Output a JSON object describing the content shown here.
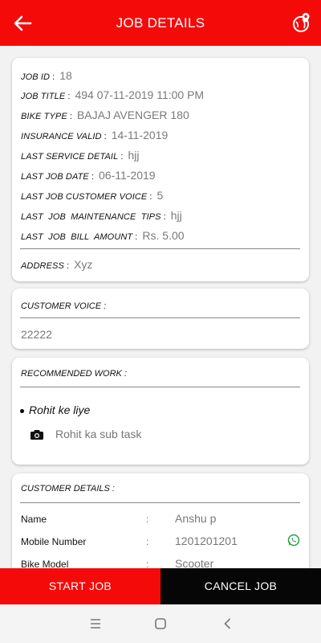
{
  "appbar": {
    "title": "JOB DETAILS",
    "back_icon": "arrow-left-icon",
    "map_icon": "map-pin-globe-icon",
    "color": "#f50a0a"
  },
  "job": {
    "job_id": {
      "label": "JOB ID",
      "value": "18"
    },
    "job_title": {
      "label": "JOB TITLE",
      "value": "494 07-11-2019 11:00 PM"
    },
    "bike_type": {
      "label": "BIKE TYPE",
      "value": "BAJAJ AVENGER 180"
    },
    "insurance_valid": {
      "label": "INSURANCE VALID",
      "value": "14-11-2019"
    },
    "last_service_detail": {
      "label": "LAST SERVICE DETAIL",
      "value": "hjj"
    },
    "last_job_date": {
      "label": "LAST JOB DATE",
      "value": "06-11-2019"
    },
    "last_job_customer_voice": {
      "label": "LAST JOB CUSTOMER VOICE",
      "value": "5"
    },
    "last_job_maintenance_tips": {
      "label": "LAST  JOB  MAINTENANCE  TIPS",
      "value": "hjj"
    },
    "last_job_bill_amount": {
      "label": "LAST  JOB  BILL  AMOUNT",
      "value": "Rs. 5.00"
    },
    "address": {
      "label": "ADDRESS",
      "value": "Xyz"
    }
  },
  "customer_voice": {
    "label": "CUSTOMER VOICE :",
    "value": "22222"
  },
  "recommended_work": {
    "label": "RECOMMENDED WORK :",
    "task": "Rohit ke liye",
    "subtask": "Rohit ka sub task",
    "subtask_icon": "camera-icon"
  },
  "customer_details": {
    "label": "CUSTOMER DETAILS :",
    "rows": [
      {
        "label": "Name",
        "value": "Anshu p"
      },
      {
        "label": "Mobile Number",
        "value": "1201201201"
      },
      {
        "label": "Bike Model",
        "value": "Scooter"
      }
    ],
    "whatsapp_icon": "whatsapp-icon",
    "whatsapp_color": "#25a244"
  },
  "actions": {
    "start": "START JOB",
    "cancel": "CANCEL JOB"
  },
  "system_nav": {
    "recents": "menu-lines-icon",
    "home": "square-home-icon",
    "back": "chevron-left-icon"
  }
}
